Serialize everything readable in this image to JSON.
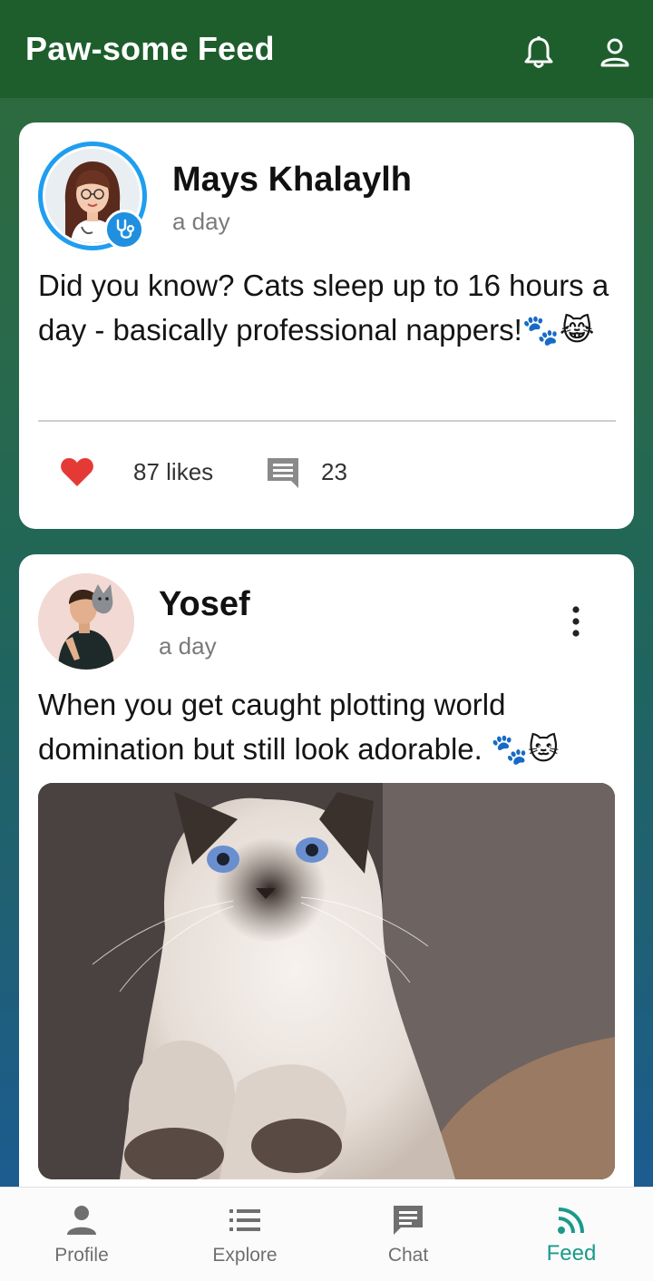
{
  "app_bar": {
    "title": "Paw-some Feed",
    "icons": [
      "bell-icon",
      "account-icon"
    ],
    "background": "#1e5e2c"
  },
  "posts": [
    {
      "author": "Mays Khalaylh",
      "time": "a day",
      "text": "Did you know? Cats sleep up to 16 hours a day - basically professional nappers!🐾😹",
      "likes": "87 likes",
      "comments": "23",
      "avatar": "female-vet-avatar",
      "badge": "stethoscope-icon",
      "ring_color": "#1f9ef0"
    },
    {
      "author": "Yosef",
      "time": "a day",
      "text": "When you get caught plotting world domination but still look adorable. 🐾🐱",
      "avatar": "man-with-cat-avatar",
      "image": "siamese-kitten-photo"
    }
  ],
  "bottom_nav": {
    "items": [
      {
        "label": "Profile",
        "icon": "person-icon"
      },
      {
        "label": "Explore",
        "icon": "list-icon"
      },
      {
        "label": "Chat",
        "icon": "chat-icon"
      },
      {
        "label": "Feed",
        "icon": "rss-icon"
      }
    ],
    "active": "Feed",
    "active_color": "#1a9a8a"
  },
  "colors": {
    "like": "#e53935",
    "comment_icon": "#8a8a8a"
  }
}
